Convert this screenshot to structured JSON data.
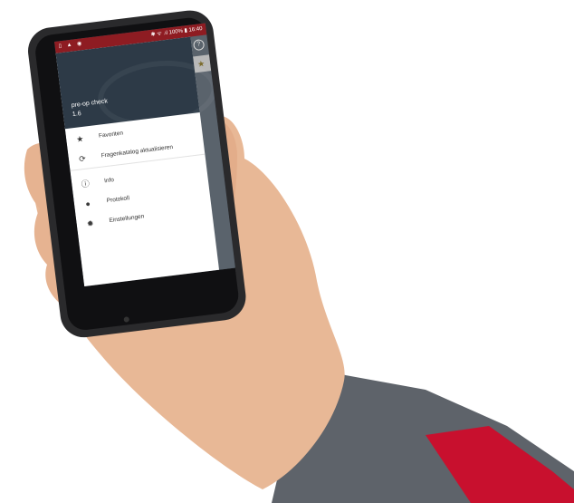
{
  "statusbar": {
    "left_icons": "▯ ▲ ◉",
    "right": "✱ ᯤ .ıl 100% ▮ 16:40"
  },
  "drawer": {
    "app_name": "pre-op check",
    "app_version": "1.6",
    "menu": [
      {
        "icon": "star-icon",
        "glyph": "★",
        "label": "Favoriten"
      },
      {
        "icon": "refresh-icon",
        "glyph": "⟳",
        "label": "Fragenkatalog aktualisieren"
      },
      {
        "icon": "info-icon",
        "glyph": "ⓘ",
        "label": "Info"
      },
      {
        "icon": "alert-icon",
        "glyph": "●",
        "label": "Protokoll"
      },
      {
        "icon": "gear-icon",
        "glyph": "✹",
        "label": "Einstellungen"
      }
    ]
  },
  "behind": {
    "help_glyph": "?",
    "star_glyph": "★"
  },
  "colors": {
    "statusbar": "#8e1c22",
    "drawer_header": "#2d3a47",
    "sleeve_red": "#c8102e",
    "sleeve_gray": "#5a5f66"
  }
}
